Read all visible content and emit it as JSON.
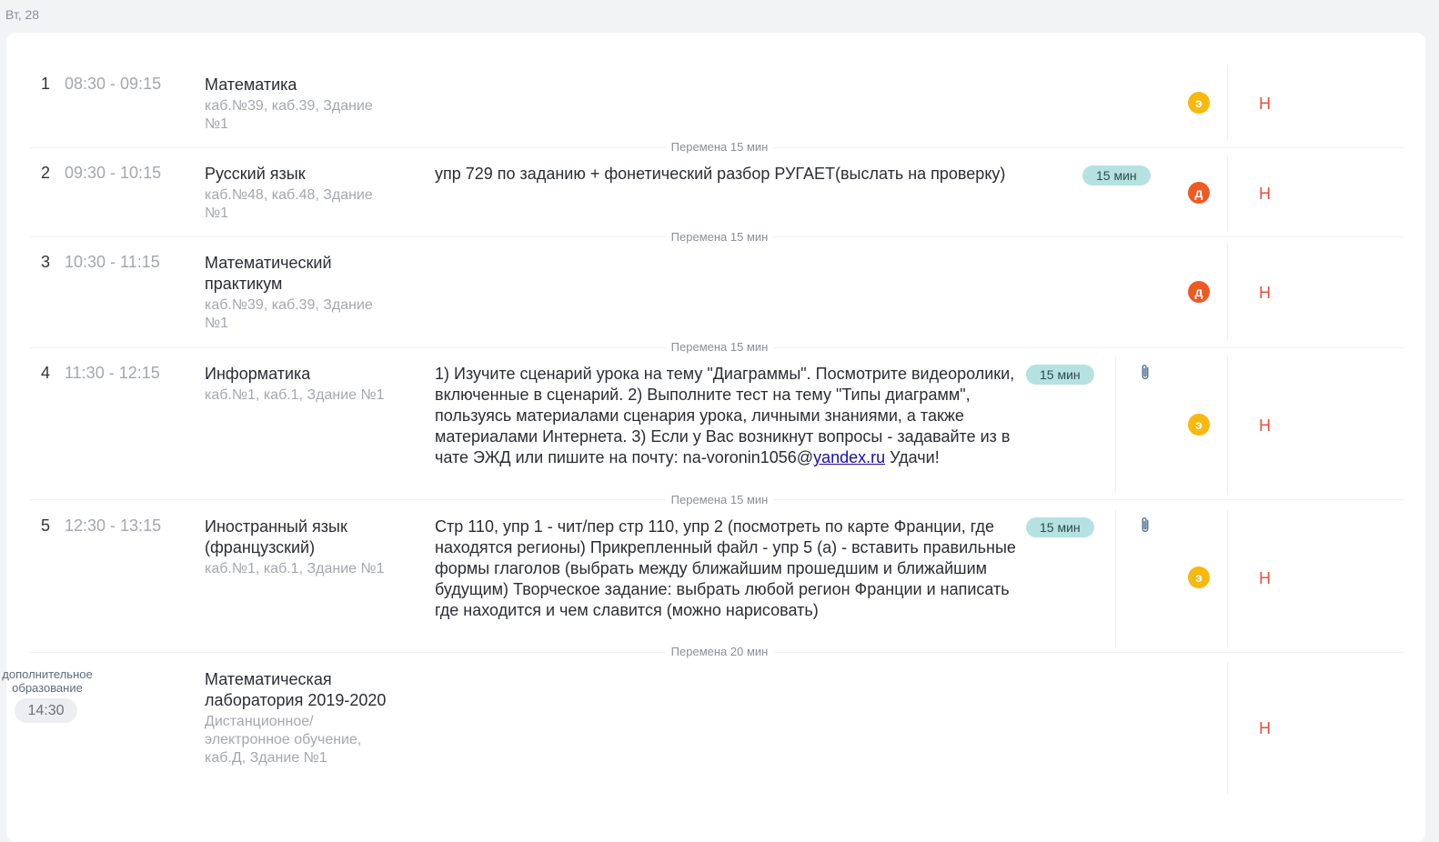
{
  "day": "Вт, 28",
  "lessons": [
    {
      "num": "1",
      "time": "08:30 - 09:15",
      "subject": "Математика",
      "room": "каб.№39, каб.39, Здание №1",
      "homework": "",
      "badge": "э",
      "mark": "Н"
    },
    {
      "num": "2",
      "time": "09:30 - 10:15",
      "subject": "Русский язык",
      "room": "каб.№48, каб.48, Здание №1",
      "homework": "упр 729 по заданию + фонетический разбор РУГАЕТ(выслать на проверку)",
      "duration": "15 мин",
      "badge": "д",
      "mark": "Н"
    },
    {
      "num": "3",
      "time": "10:30 - 11:15",
      "subject": "Математический практикум",
      "room": "каб.№39, каб.39, Здание №1",
      "homework": "",
      "badge": "д",
      "mark": "Н"
    },
    {
      "num": "4",
      "time": "11:30 - 12:15",
      "subject": "Информатика",
      "room": "каб.№1, каб.1, Здание №1",
      "homework_before_link": "1) Изучите сценарий урока на тему \"Диаграммы\". Посмотрите видеоролики, включенные в сценарий. 2) Выполните тест на тему \"Типы диаграмм\", пользуясь материалами сценария урока, личными знаниями, а также материалами Интернета. 3) Если у Вас возникнут вопросы - задавайте из в чате ЭЖД или пишите на почту: na-voronin1056@",
      "homework_link": "yandex.ru",
      "homework_after_link": " Удачи!",
      "duration": "15 мин",
      "badge": "э",
      "mark": "Н"
    },
    {
      "num": "5",
      "time": "12:30 - 13:15",
      "subject": "Иностранный язык (французский)",
      "room": "каб.№1, каб.1, Здание №1",
      "homework": "Стр 110, упр 1 - чит/пер стр 110, упр 2 (посмотреть по карте Франции, где находятся регионы) Прикрепленный файл - упр 5 (а) - вставить правильные формы глаголов (выбрать между ближайшим прошедшим и ближайшим будущим) Творческое задание: выбрать любой регион Франции и написать где находится и чем славится (можно нарисовать)",
      "duration": "15 мин",
      "badge": "э",
      "mark": "Н"
    }
  ],
  "breaks": [
    "Перемена 15 мин",
    "Перемена 15 мин",
    "Перемена 15 мин",
    "Перемена 15 мин",
    "Перемена 20 мин"
  ],
  "extra": {
    "tag": "дополнительное образование",
    "time": "14:30",
    "subject": "Математическая лаборатория 2019-2020",
    "room": "Дистанционное/ электронное обучение, каб.Д, Здание №1",
    "mark": "Н"
  },
  "colors": {
    "badge_e": "#f7b80f",
    "badge_d": "#ee5a24",
    "mark": "#ee4e3a",
    "duration_bg": "#b5e2e0"
  },
  "icons": {
    "attachment": "paperclip-icon"
  }
}
